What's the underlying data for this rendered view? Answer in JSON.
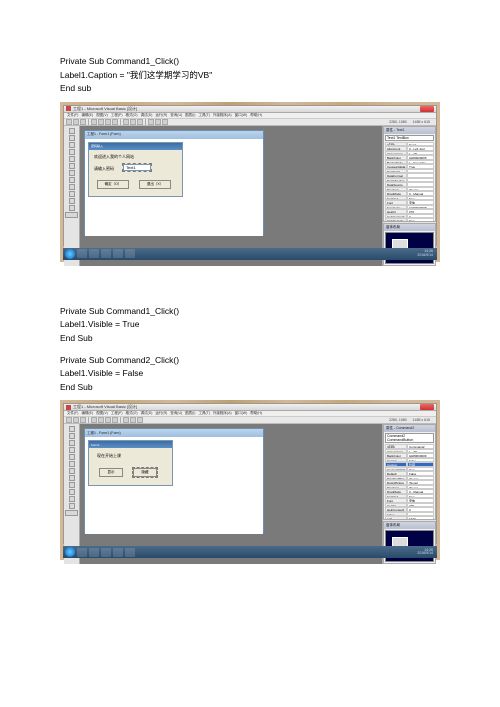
{
  "code1": {
    "l1": "Private Sub Command1_Click()",
    "l2": "Label1.Caption = \"我们这学期学习的VB\"",
    "l3": "End sub"
  },
  "code2a": {
    "l1": "Private Sub Command1_Click()",
    "l2": "Label1.Visible = True",
    "l3": "End Sub"
  },
  "code2b": {
    "l1": "Private Sub Command2_Click()",
    "l2": "Label1.Visible = False",
    "l3": "End Sub"
  },
  "ide": {
    "title": "工程1 - Microsoft Visual Basic [设计]",
    "menu": [
      "文件(F)",
      "编辑(E)",
      "视图(V)",
      "工程(P)",
      "格式(O)",
      "调试(D)",
      "运行(R)",
      "查询(U)",
      "图表(I)",
      "工具(T)",
      "外接程序(A)",
      "窗口(W)",
      "帮助(H)"
    ],
    "coords1": "2280, 1080",
    "coords2": "1455 x 615"
  },
  "shot1": {
    "form_title": "工程1 - Form1 (Form)",
    "dialog_title": "密码输入",
    "label1": "欢迎进入我的个人网站",
    "label2": "请输入密码",
    "input_val": "Text1",
    "btn_ok": "确定（O）",
    "btn_cancel": "退出（X）",
    "props_panel_title": "属性 - Text1",
    "props_object": "Text1 TextBox",
    "props": [
      [
        "(名称)",
        "Text1"
      ],
      [
        "Alignment",
        "0 - Left Just"
      ],
      [
        "Appearance",
        "1 - 3D"
      ],
      [
        "BackColor",
        "&H80000005"
      ],
      [
        "BorderStyle",
        "1 - Fixed Sin"
      ],
      [
        "CausesValida",
        "True"
      ],
      [
        "DataField",
        ""
      ],
      [
        "DataFormat",
        ""
      ],
      [
        "DataMember",
        ""
      ],
      [
        "DataSource",
        ""
      ],
      [
        "DragIcon",
        "(None)"
      ],
      [
        "DragMode",
        "0 - Manual"
      ],
      [
        "Enabled",
        "True"
      ],
      [
        "Font",
        "宋体"
      ],
      [
        "ForeColor",
        "&H80000008"
      ],
      [
        "Height",
        "270"
      ],
      [
        "HelpContextI",
        "0"
      ],
      [
        "HideSelectio",
        "True"
      ],
      [
        "IMEMode",
        "0 - No Opera"
      ],
      [
        "Index",
        ""
      ],
      [
        "Left",
        "1680"
      ]
    ],
    "layout_panel_title": "窗体布局"
  },
  "shot2": {
    "form_title": "工程1 - Form1 (Form)",
    "inner_title": "Form1",
    "label1": "现在开始上课",
    "btn1": "显示",
    "btn2": "隐藏",
    "props_panel_title": "属性 - Command2",
    "props_object": "Command2 CommandButton",
    "props": [
      [
        "(名称)",
        "Command2"
      ],
      [
        "Appearance",
        "1 - 3D"
      ],
      [
        "BackColor",
        "&H8000000F"
      ],
      [
        "Cancel",
        "False"
      ],
      [
        "Caption",
        "隐藏"
      ],
      [
        "CausesValida",
        "True"
      ],
      [
        "Default",
        "False"
      ],
      [
        "DisabledPict",
        "(None)"
      ],
      [
        "DownPicture",
        "(None)"
      ],
      [
        "DragIcon",
        "(None)"
      ],
      [
        "DragMode",
        "0 - Manual"
      ],
      [
        "Enabled",
        "True"
      ],
      [
        "Font",
        "宋体"
      ],
      [
        "Height",
        "375"
      ],
      [
        "HelpContextI",
        "0"
      ],
      [
        "Index",
        ""
      ],
      [
        "Left",
        "1920"
      ],
      [
        "MaskColor",
        "&H00C0C0C0"
      ],
      [
        "MouseIcon",
        "(None)"
      ],
      [
        "MousePointer",
        "0 - Default"
      ],
      [
        "OLEDropMode",
        "0 - None"
      ]
    ],
    "layout_panel_title": "窗体布局"
  },
  "taskbar": {
    "time": "14:26",
    "date": "2016/9/14"
  }
}
